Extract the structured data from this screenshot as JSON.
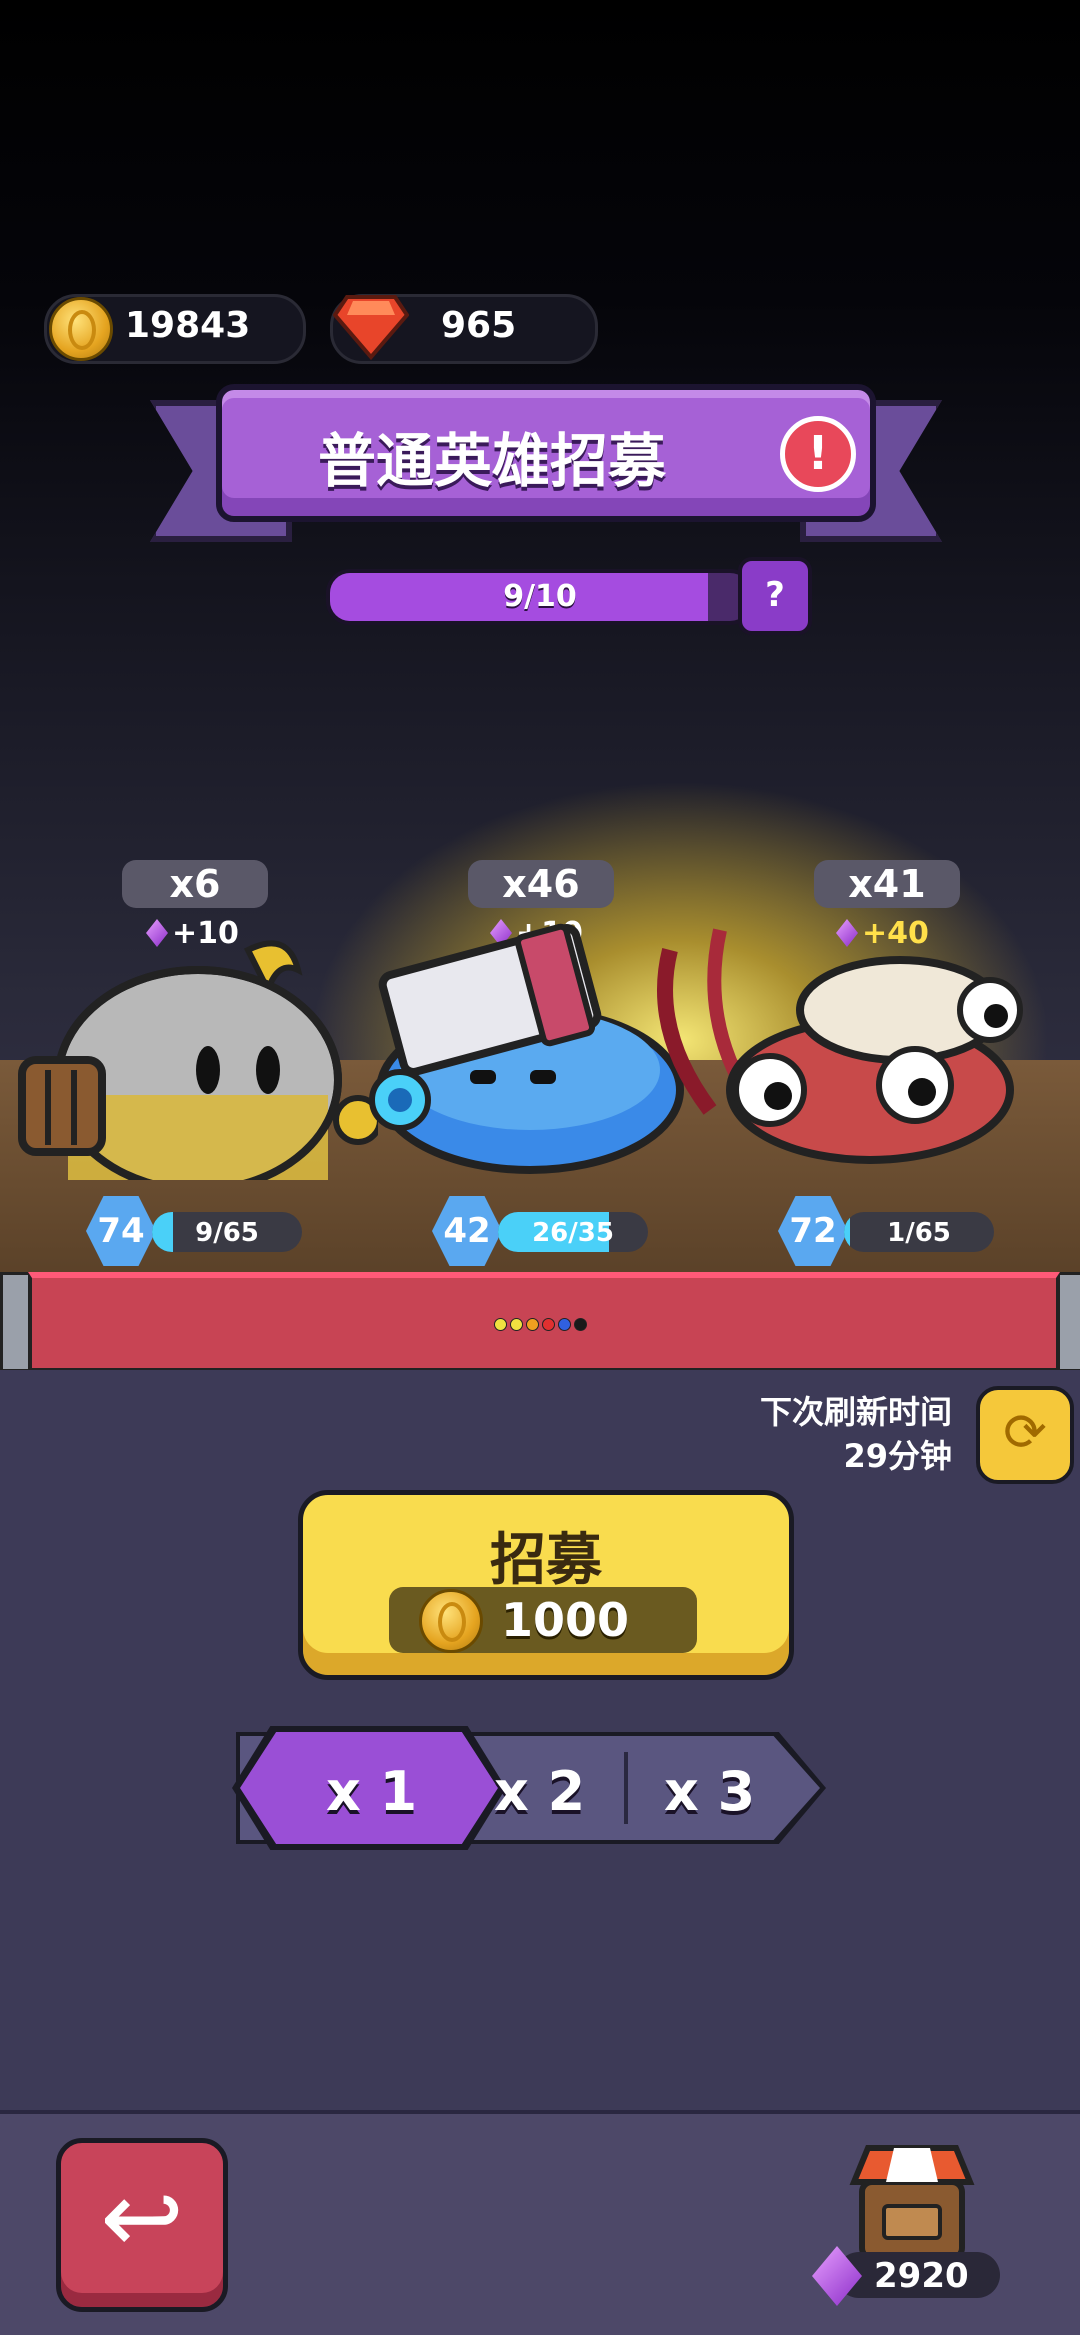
{
  "currency": {
    "coins": "19843",
    "rubies": "965"
  },
  "banner": {
    "title": "普通英雄招募"
  },
  "progress": {
    "text": "9/10",
    "value": 0.9
  },
  "heroes": [
    {
      "count": "x6",
      "bonus": "+10",
      "bonus_color": "#ffffff",
      "level": "74",
      "shards": "9/65",
      "shard_fraction": 0.14
    },
    {
      "count": "x46",
      "bonus": "+10",
      "bonus_color": "#ffffff",
      "level": "42",
      "shards": "26/35",
      "shard_fraction": 0.74
    },
    {
      "count": "x41",
      "bonus": "+40",
      "bonus_color": "#ffe04a",
      "level": "72",
      "shards": "1/65",
      "shard_fraction": 0.02
    }
  ],
  "stage_dots": [
    "#f0e040",
    "#f0e040",
    "#f0a020",
    "#e03030",
    "#3060e0",
    "#1a1a1a"
  ],
  "refresh": {
    "line1": "下次刷新时间",
    "line2": "29分钟"
  },
  "recruit": {
    "label": "招募",
    "cost": "1000"
  },
  "multipliers": {
    "x1": "x 1",
    "x2": "x 2",
    "x3": "x 3",
    "selected": "x 1"
  },
  "shop": {
    "gems": "2920"
  },
  "colors": {
    "accent_purple": "#a661d6",
    "button_yellow": "#f9dc4e",
    "back_red": "#c8445a"
  }
}
